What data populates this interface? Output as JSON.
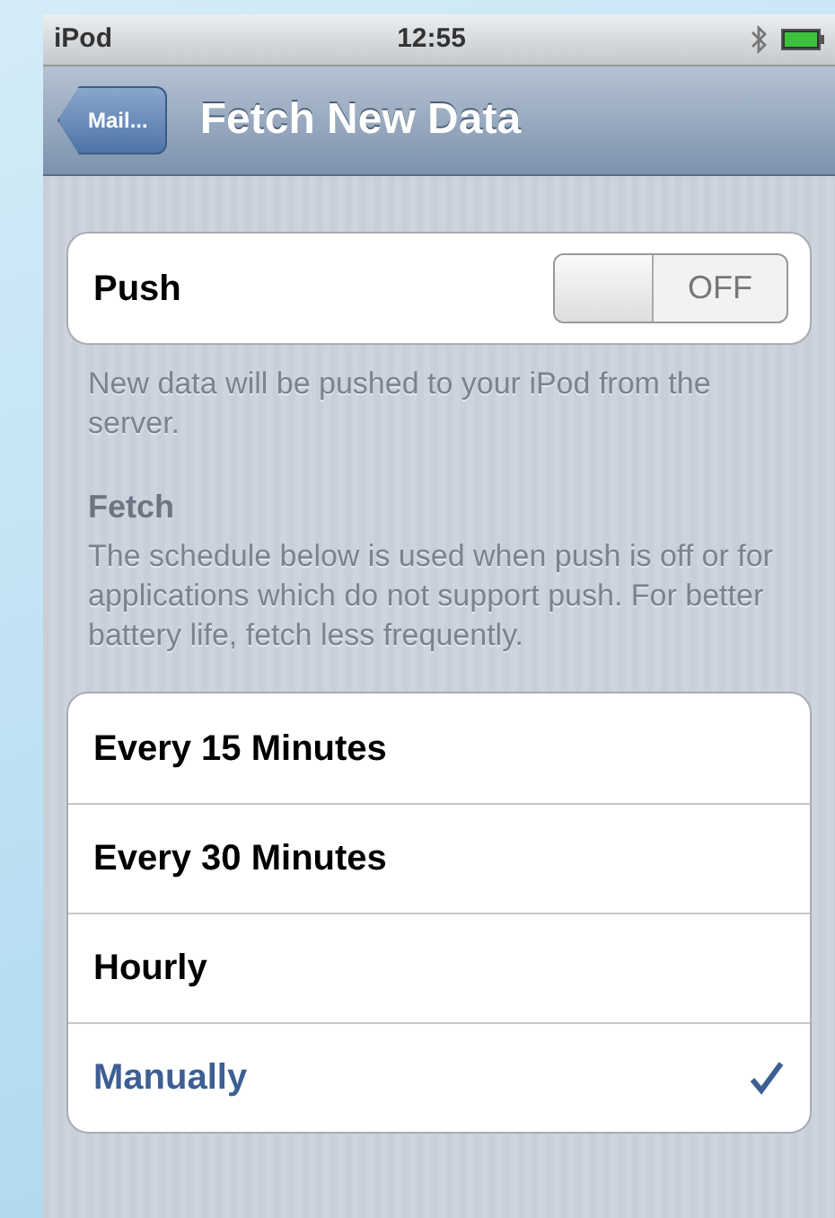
{
  "status_bar": {
    "carrier": "iPod",
    "time": "12:55"
  },
  "nav_bar": {
    "back_button": "Mail...",
    "title": "Fetch New Data"
  },
  "push": {
    "label": "Push",
    "on": false,
    "switch_label": "OFF",
    "footer": "New data will be pushed to your iPod from the server."
  },
  "fetch": {
    "header": "Fetch",
    "description": "The schedule below is used when push is off or for applications which do not support push. For better battery life, fetch less frequently.",
    "options": [
      {
        "label": "Every 15 Minutes",
        "selected": false
      },
      {
        "label": "Every 30 Minutes",
        "selected": false
      },
      {
        "label": "Hourly",
        "selected": false
      },
      {
        "label": "Manually",
        "selected": true
      }
    ]
  }
}
